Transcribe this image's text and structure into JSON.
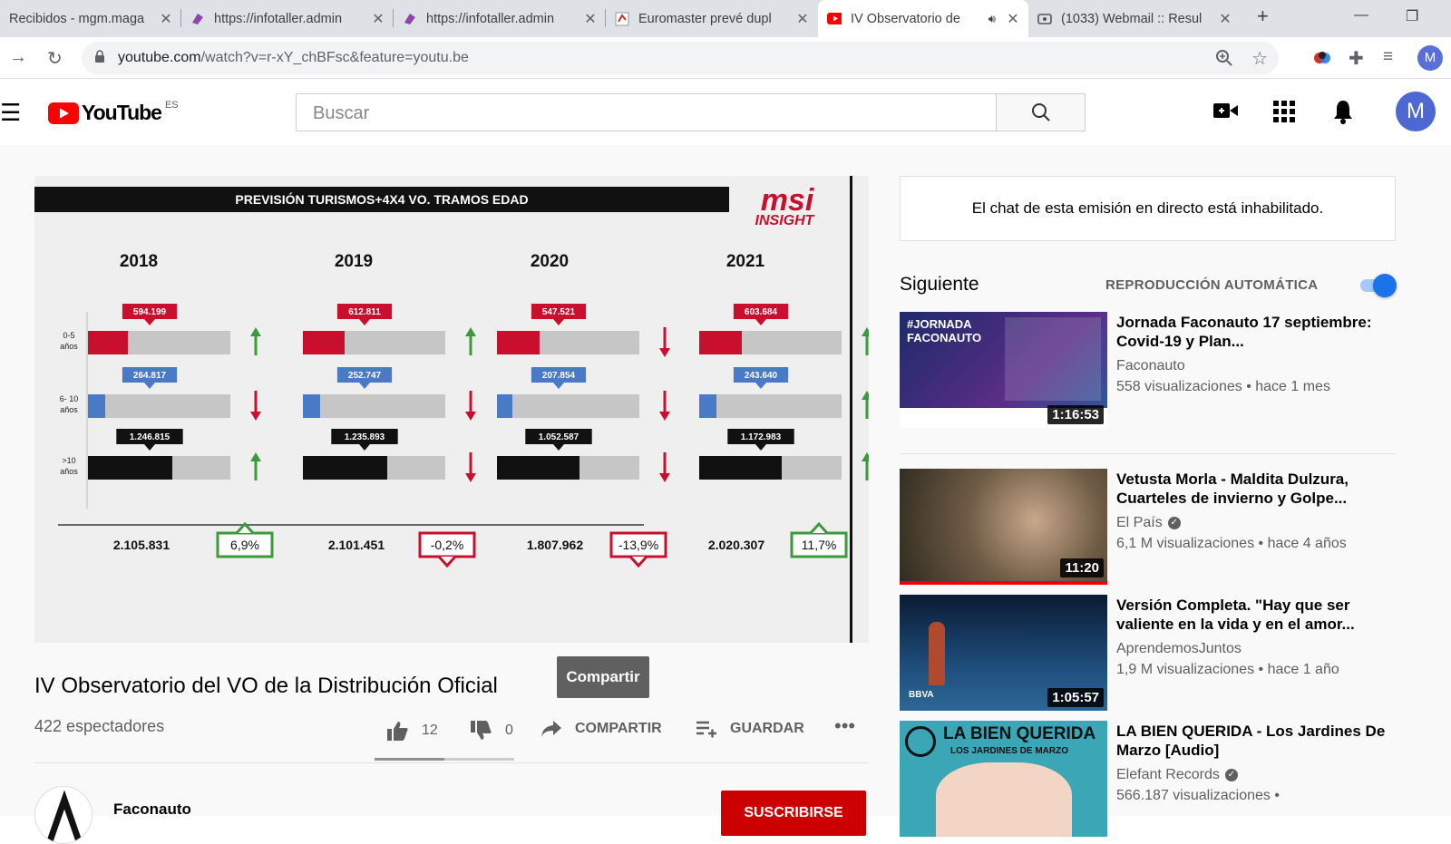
{
  "browser": {
    "tabs": [
      {
        "title": "Recibidos - mgm.maga",
        "active": false
      },
      {
        "title": "https://infotaller.admin",
        "active": false
      },
      {
        "title": "https://infotaller.admin",
        "active": false
      },
      {
        "title": "Euromaster prevé dupl",
        "active": false
      },
      {
        "title": "IV Observatorio de",
        "active": true
      },
      {
        "title": "(1033) Webmail :: Resul",
        "active": false
      }
    ],
    "url_host": "youtube.com",
    "url_path": "/watch?v=r-xY_chBFsc&feature=youtu.be",
    "profile_initial": "M"
  },
  "header": {
    "logo_text": "YouTube",
    "region": "ES",
    "search_placeholder": "Buscar",
    "avatar_initial": "M"
  },
  "video": {
    "slide_title": "PREVISIÓN TURISMOS+4X4 VO. TRAMOS EDAD",
    "brand_line1": "msi",
    "brand_line2": "INSIGHT",
    "years": [
      "2018",
      "2019",
      "2020",
      "2021"
    ],
    "row_labels": [
      [
        "0-5",
        "años"
      ],
      [
        "6- 10",
        "años"
      ],
      [
        ">10",
        "años"
      ]
    ],
    "cells": [
      [
        {
          "value": "594.199",
          "share": 0.28,
          "trend": "up"
        },
        {
          "value": "264.817",
          "share": 0.12,
          "trend": "down"
        },
        {
          "value": "1.246.815",
          "share": 0.59,
          "trend": "up"
        }
      ],
      [
        {
          "value": "612.811",
          "share": 0.29,
          "trend": "up"
        },
        {
          "value": "252.747",
          "share": 0.12,
          "trend": "down"
        },
        {
          "value": "1.235.893",
          "share": 0.59,
          "trend": "down"
        }
      ],
      [
        {
          "value": "547.521",
          "share": 0.3,
          "trend": "down"
        },
        {
          "value": "207.854",
          "share": 0.11,
          "trend": "down"
        },
        {
          "value": "1.052.587",
          "share": 0.58,
          "trend": "down"
        }
      ],
      [
        {
          "value": "603.684",
          "share": 0.3,
          "trend": "up"
        },
        {
          "value": "243.640",
          "share": 0.12,
          "trend": "up"
        },
        {
          "value": "1.172.983",
          "share": 0.58,
          "trend": "up"
        }
      ]
    ],
    "totals": [
      "2.105.831",
      "2.101.451",
      "1.807.962",
      "2.020.307"
    ],
    "changes": [
      {
        "label": "6,9%",
        "dir": "up"
      },
      {
        "label": "-0,2%",
        "dir": "down"
      },
      {
        "label": "-13,9%",
        "dir": "down"
      },
      {
        "label": "11,7%",
        "dir": "up"
      }
    ],
    "colors": {
      "young": "#c8102e",
      "mid": "#4a7ac6",
      "old": "#111111",
      "bar_bg": "#c6c6c6",
      "up": "#3c9a3c",
      "down": "#c8102e"
    }
  },
  "share_popup": "Compartir",
  "title": "IV Observatorio del VO de la Distribución Oficial",
  "viewers": "422 espectadores",
  "actions": {
    "likes": "12",
    "dislikes": "0",
    "share": "COMPARTIR",
    "save": "GUARDAR"
  },
  "like_ratio": 1.0,
  "channel": {
    "name": "Faconauto",
    "subscribe": "SUSCRIBIRSE"
  },
  "chat_disabled": "El chat de esta emisión en directo está inhabilitado.",
  "next": {
    "heading": "Siguiente",
    "autoplay": "REPRODUCCIÓN AUTOMÁTICA",
    "autoplay_on": true
  },
  "recommendations": [
    {
      "title": "Jornada Faconauto 17 septiembre: Covid-19 y Plan...",
      "channel": "Faconauto",
      "verified": false,
      "meta": "558 visualizaciones • hace 1 mes",
      "duration": "1:16:53",
      "thumb_text": "#JORNADA FACONAUTO"
    },
    {
      "title": "Vetusta Morla - Maldita Dulzura, Cuarteles de invierno y Golpe...",
      "channel": "El País",
      "verified": true,
      "meta": "6,1 M visualizaciones • hace 4 años",
      "duration": "11:20"
    },
    {
      "title": "Versión Completa. \"Hay que ser valiente en la vida y en el amor...",
      "channel": "AprendemosJuntos",
      "verified": false,
      "meta": "1,9 M visualizaciones • hace 1 año",
      "duration": "1:05:57",
      "thumb_text": "BBVA"
    },
    {
      "title": "LA BIEN QUERIDA - Los Jardines De Marzo [Audio]",
      "channel": "Elefant Records",
      "verified": true,
      "meta": "566.187 visualizaciones •",
      "duration": "",
      "thumb_text": "LA BIEN QUERIDA",
      "thumb_sub": "LOS JARDINES DE MARZO"
    }
  ]
}
